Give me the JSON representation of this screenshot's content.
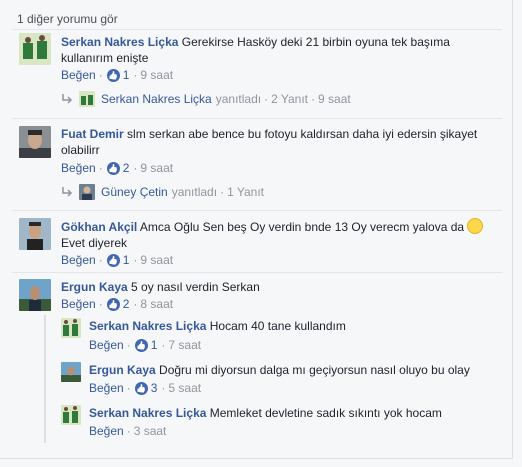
{
  "view_more": "1 diğer yorumu gör",
  "labels": {
    "like": "Beğen"
  },
  "comments": [
    {
      "author": "Serkan Nakres Liçka",
      "text": "Gerekirse Hasköy deki 21 birbin oyuna tek başıma kullanırım enişte",
      "reactions": "1",
      "time": "9 saat",
      "reply_summary": {
        "author": "Serkan Nakres Liçka",
        "action": "yanıtladı",
        "count": "2 Yanıt",
        "time": "9 saat"
      }
    },
    {
      "author": "Fuat Demir",
      "text": "slm serkan abe bence bu fotoyu kaldırsan daha iyi edersin şikayet olabilirr",
      "reactions": "2",
      "time": "9 saat",
      "reply_summary": {
        "author": "Güney Çetin",
        "action": "yanıtladı",
        "count": "1 Yanıt"
      }
    },
    {
      "author": "Gökhan Akçil",
      "text": "Amca Oğlu Sen beş Oy verdin bnde 13 Oy verecm yalova da",
      "text2": "Evet diyerek",
      "reactions": "1",
      "time": "9 saat"
    },
    {
      "author": "Ergun Kaya",
      "text": "5 oy nasıl verdin Serkan",
      "reactions": "2",
      "time": "8 saat",
      "replies": [
        {
          "author": "Serkan Nakres Liçka",
          "text": "Hocam 40 tane kullandım",
          "reactions": "1",
          "time": "7 saat"
        },
        {
          "author": "Ergun Kaya",
          "text": "Doğru mi diyorsun dalga mı geçiyorsun nasıl oluyo bu olay",
          "reactions": "3",
          "time": "5 saat"
        },
        {
          "author": "Serkan Nakres Liçka",
          "text": "Memleket devletine sadık sıkıntı yok hocam",
          "time": "3 saat"
        }
      ]
    }
  ]
}
